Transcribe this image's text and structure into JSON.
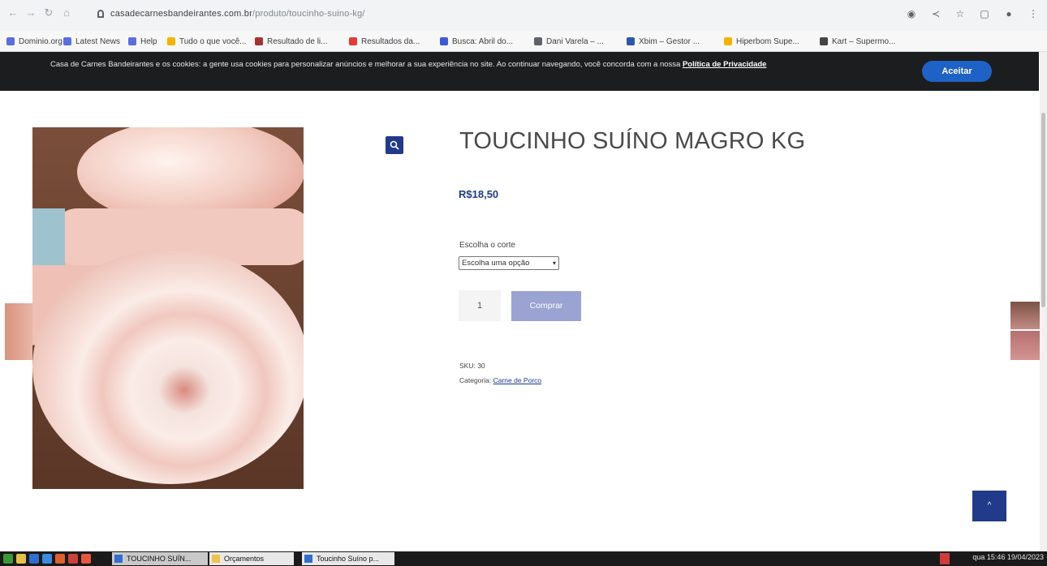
{
  "browser": {
    "url_host": "casadecarnesbandeirantes.com.br",
    "url_path": "/produto/toucinho-suino-kg/",
    "bookmarks": [
      "Dominio.org",
      "Latest News",
      "Help",
      "Tudo o que você...",
      "Resultado de li...",
      "Resultados da...",
      "Busca: Abril do...",
      "Dani Varela – ...",
      "Xbim – Gestor ...",
      "Hiperbom Supe...",
      "Kart – Supermo..."
    ]
  },
  "cookie_banner": {
    "text": "Casa de Carnes Bandeirantes e os cookies: a gente usa cookies para personalizar anúncios e melhorar a sua experiência no site. Ao continuar navegando, você concorda com a nossa",
    "link_text": "Política de Privacidade",
    "accept_label": "Aceitar"
  },
  "product": {
    "title": "TOUCINHO SUÍNO MAGRO KG",
    "price": "R$18,50",
    "variation_label": "Escolha o corte",
    "variation_selected": "Escolha uma opção",
    "quantity": "1",
    "buy_label": "Comprar",
    "sku": "SKU: 30",
    "category_prefix": "Categoria:",
    "category_link": "Carne de Porco"
  },
  "scroll_top_label": "^",
  "taskbar": {
    "tasks": [
      "TOUCINHO SUÍN...",
      "Orçamentos",
      "Toucinho Suíno p..."
    ],
    "clock": "qua 15:46 19/04/2023"
  },
  "colors": {
    "accent": "#213a8a",
    "price": "#1e3a8a",
    "button_disabled": "#9aa3d1",
    "cookie_bg": "#1c1d1f",
    "accept_bg": "#1f62c5"
  }
}
